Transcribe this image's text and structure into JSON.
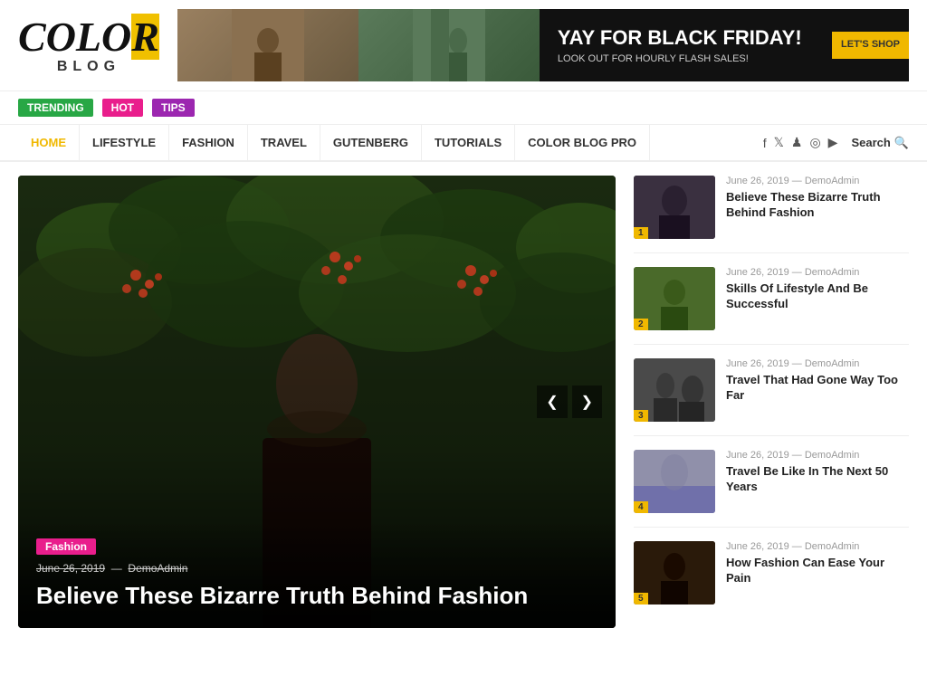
{
  "logo": {
    "color_text": "COLOR",
    "blog_text": "BLOG"
  },
  "banner": {
    "title": "YAY FOR BLACK FRIDAY!",
    "subtitle": "LOOK OUT FOR HOURLY FLASH SALES!",
    "button": "LET'S SHOP"
  },
  "tags": [
    {
      "label": "TRENDING",
      "class": "tag-trending"
    },
    {
      "label": "HOT",
      "class": "tag-hot"
    },
    {
      "label": "TIPS",
      "class": "tag-tips"
    }
  ],
  "nav": {
    "items": [
      {
        "label": "HOME",
        "active": true
      },
      {
        "label": "LIFESTYLE",
        "active": false
      },
      {
        "label": "FASHION",
        "active": false
      },
      {
        "label": "TRAVEL",
        "active": false
      },
      {
        "label": "GUTENBERG",
        "active": false
      },
      {
        "label": "TUTORIALS",
        "active": false
      },
      {
        "label": "COLOR BLOG PRO",
        "active": false
      }
    ],
    "social": [
      "f",
      "𝕏",
      "𝗣",
      "◎",
      "▶"
    ],
    "search_label": "Search"
  },
  "hero": {
    "category": "Fashion",
    "date": "June 26, 2019",
    "author": "DemoAdmin",
    "title": "Believe These Bizarre Truth Behind Fashion",
    "prev_icon": "❮",
    "next_icon": "❯"
  },
  "sidebar_items": [
    {
      "num": "1",
      "date": "June 26, 2019",
      "author": "DemoAdmin",
      "title": "Believe These Bizarre Truth Behind Fashion",
      "thumb_class": "t1"
    },
    {
      "num": "2",
      "date": "June 26, 2019",
      "author": "DemoAdmin",
      "title": "Skills Of Lifestyle And Be Successful",
      "thumb_class": "t2"
    },
    {
      "num": "3",
      "date": "June 26, 2019",
      "author": "DemoAdmin",
      "title": "Travel That Had Gone Way Too Far",
      "thumb_class": "t3"
    },
    {
      "num": "4",
      "date": "June 26, 2019",
      "author": "DemoAdmin",
      "title": "Travel Be Like In The Next 50 Years",
      "thumb_class": "t4"
    },
    {
      "num": "5",
      "date": "June 26, 2019",
      "author": "DemoAdmin",
      "title": "How Fashion Can Ease Your Pain",
      "thumb_class": "t5"
    }
  ],
  "colors": {
    "accent_yellow": "#f0b800",
    "accent_pink": "#e91e8c",
    "accent_green": "#28a745",
    "accent_purple": "#9c27b0"
  }
}
